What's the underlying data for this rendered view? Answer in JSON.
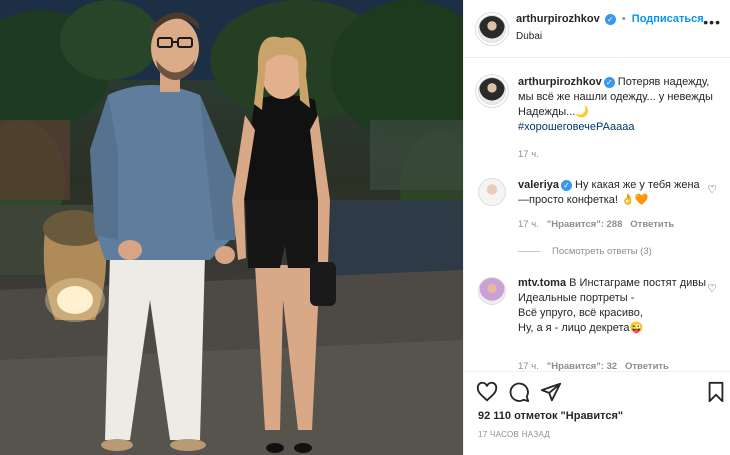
{
  "post": {
    "author": "arthurpirozhkov",
    "follow_label": "Подписаться",
    "separator": "•",
    "location": "Dubai",
    "more_icon": "ellipsis-icon"
  },
  "caption": {
    "username": "arthurpirozhkov",
    "text": "Потеряв надежду, мы всё же нашли одежду... у невежды Надежды...🌙",
    "hashtag": "#хорошеговечеРАаааа",
    "age": "17 ч."
  },
  "comments": [
    {
      "username": "valeriya",
      "verified": true,
      "text": "Ну какая же у тебя жена —просто конфетка! 👌🧡",
      "age": "17 ч.",
      "likes": "\"Нравится\": 288",
      "reply": "Ответить",
      "view_replies": "Посмотреть ответы (3)"
    },
    {
      "username": "mtv.toma",
      "verified": false,
      "text_lines": [
        "В Инстаграме постят дивы",
        "Идеальные портреты -",
        "Всё упруго, всё красиво,",
        "Ну, а я - лицо декрета😜"
      ],
      "age": "17 ч.",
      "likes": "\"Нравится\": 32",
      "reply": "Ответить"
    }
  ],
  "engagement": {
    "likes": "92 110 отметок \"Нравится\"",
    "timestamp": "17 ЧАСОВ НАЗАД"
  },
  "colors": {
    "accent": "#0095f6",
    "verified": "#3897f0",
    "text": "#262626",
    "muted": "#8e8e8e",
    "border": "#efefef"
  }
}
